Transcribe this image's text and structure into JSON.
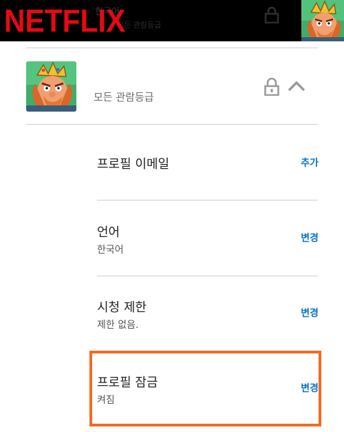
{
  "brand": {
    "logo_text": "NETFLIX",
    "logo_color": "#e50914"
  },
  "header": {
    "ghost_name": "한국어",
    "ghost_rating": "모든 관람등급"
  },
  "profile": {
    "rating_label": "모든 관람등급",
    "lock_icon": "lock-icon",
    "collapse_icon": "chevron-up-icon"
  },
  "settings": [
    {
      "title": "프로필 이메일",
      "subtitle": "",
      "action": "추가"
    },
    {
      "title": "언어",
      "subtitle": "한국어",
      "action": "변경"
    },
    {
      "title": "시청 제한",
      "subtitle": "제한 없음.",
      "action": "변경"
    },
    {
      "title": "프로필 잠금",
      "subtitle": "켜짐",
      "action": "변경"
    }
  ],
  "colors": {
    "accent": "#0b74c9",
    "highlight": "#f26b21",
    "topbar": "#000000"
  }
}
